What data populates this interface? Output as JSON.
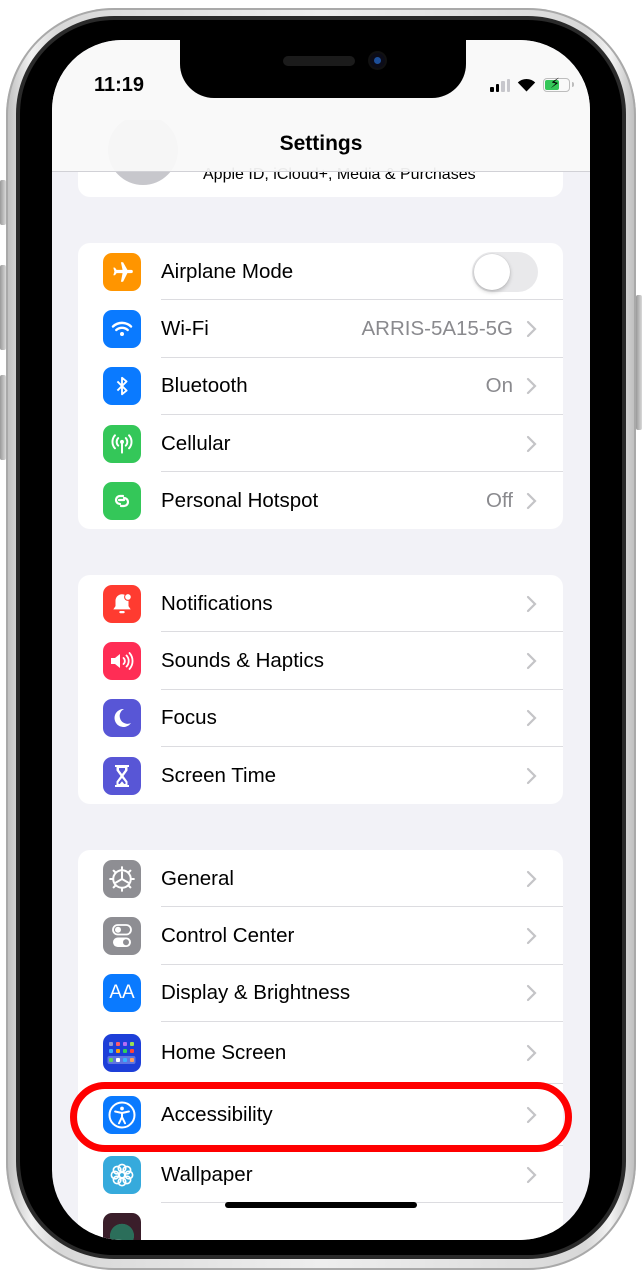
{
  "status_bar": {
    "time": "11:19",
    "signal_bars_active": 2,
    "signal_bars_total": 4,
    "wifi": "connected",
    "battery": {
      "charging": true,
      "level_percent": 60,
      "fill_color": "#34c759"
    }
  },
  "header": {
    "title": "Settings"
  },
  "apple_id": {
    "subtitle": "Apple ID, iCloud+, Media & Purchases"
  },
  "groups": [
    {
      "rows": [
        {
          "label": "Airplane Mode",
          "icon": "airplane-icon",
          "icon_color": "#ff9500",
          "toggle": true,
          "toggle_on": false
        },
        {
          "label": "Wi-Fi",
          "icon": "wifi-icon",
          "icon_color": "#0a7aff",
          "value": "ARRIS-5A15-5G"
        },
        {
          "label": "Bluetooth",
          "icon": "bluetooth-icon",
          "icon_color": "#0a7aff",
          "value": "On"
        },
        {
          "label": "Cellular",
          "icon": "cellular-antenna-icon",
          "icon_color": "#34c759",
          "value": ""
        },
        {
          "label": "Personal Hotspot",
          "icon": "hotspot-link-icon",
          "icon_color": "#34c759",
          "value": "Off"
        }
      ]
    },
    {
      "rows": [
        {
          "label": "Notifications",
          "icon": "bell-icon",
          "icon_color": "#ff3b30"
        },
        {
          "label": "Sounds & Haptics",
          "icon": "speaker-icon",
          "icon_color": "#ff2d55"
        },
        {
          "label": "Focus",
          "icon": "moon-icon",
          "icon_color": "#5856d6"
        },
        {
          "label": "Screen Time",
          "icon": "hourglass-icon",
          "icon_color": "#5856d6"
        }
      ]
    },
    {
      "rows": [
        {
          "label": "General",
          "icon": "gear-icon",
          "icon_color": "#8e8e93"
        },
        {
          "label": "Control Center",
          "icon": "switches-icon",
          "icon_color": "#8e8e93"
        },
        {
          "label": "Display & Brightness",
          "icon": "text-size-icon",
          "icon_color": "#0a7aff",
          "icon_text": "AA"
        },
        {
          "label": "Home Screen",
          "icon": "app-grid-icon",
          "icon_color": "#1d3fd8"
        },
        {
          "label": "Accessibility",
          "icon": "accessibility-icon",
          "icon_color": "#0a7aff",
          "highlighted": true
        },
        {
          "label": "Wallpaper",
          "icon": "flower-icon",
          "icon_color": "#36aadc"
        }
      ]
    }
  ],
  "annotation": {
    "highlight_color": "#ff0000",
    "target": "Accessibility"
  }
}
